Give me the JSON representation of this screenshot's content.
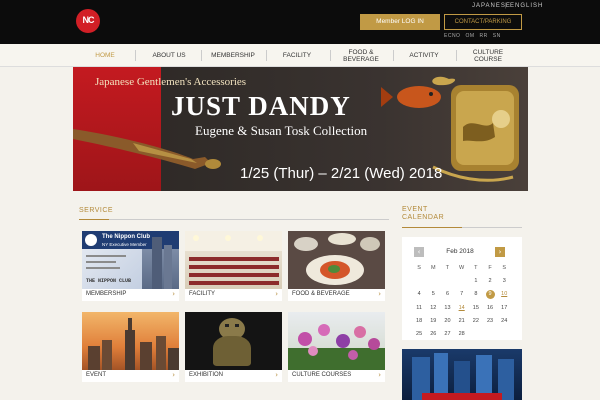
{
  "header": {
    "logo_text": "NC",
    "lang_japanese": "JAPANESE",
    "lang_english": "ENGLISH",
    "login_label": "Member LOG IN",
    "contact_label": "CONTACT/PARKING",
    "utility_links": [
      "ECNO",
      "OM",
      "RR",
      "SN"
    ]
  },
  "nav": {
    "items": [
      {
        "label": "HOME"
      },
      {
        "label": "ABOUT US"
      },
      {
        "label": "MEMBERSHIP"
      },
      {
        "label": "FACILITY"
      },
      {
        "label": "FOOD &\nBEVERAGE"
      },
      {
        "label": "ACTIVITY"
      },
      {
        "label": "CULTURE\nCOURSE"
      }
    ]
  },
  "hero": {
    "subtitle": "Japanese Gentlemen's Accessories",
    "title": "JUST DANDY",
    "collection": "Eugene & Susan Tosk Collection",
    "dates": "1/25 (Thur) – 2/21 (Wed) 2018"
  },
  "service": {
    "title": "SERVICE",
    "tiles": [
      {
        "caption": "MEMBERSHIP",
        "card_line1": "The Nippon Club",
        "card_line2": "NY Executive Member",
        "card_footer": "THE NIPPON CLUB"
      },
      {
        "caption": "FACILITY"
      },
      {
        "caption": "FOOD & BEVERAGE"
      },
      {
        "caption": "EVENT"
      },
      {
        "caption": "EXHIBITION"
      },
      {
        "caption": "CULTURE COURSES"
      }
    ]
  },
  "calendar": {
    "title_line1": "EVENT",
    "title_line2": "CALENDAR",
    "month": "Feb  2018",
    "prev_label": "‹",
    "next_label": "›",
    "weekday_headers": [
      "S",
      "M",
      "T",
      "W",
      "T",
      "F",
      "S"
    ],
    "rows": [
      [
        "",
        "",
        "",
        "",
        "1",
        "2",
        "3"
      ],
      [
        "4",
        "5",
        "6",
        "7",
        "8",
        "9",
        "10"
      ],
      [
        "11",
        "12",
        "13",
        "14",
        "15",
        "16",
        "17"
      ],
      [
        "18",
        "19",
        "20",
        "21",
        "22",
        "23",
        "24"
      ],
      [
        "25",
        "26",
        "27",
        "28",
        "",
        "",
        ""
      ]
    ],
    "today": "9",
    "event_days": [
      "14",
      "10"
    ]
  },
  "colors": {
    "accent_gold": "#c19a45",
    "header_bg": "#0c0c0c",
    "brand_red": "#d21f26"
  }
}
